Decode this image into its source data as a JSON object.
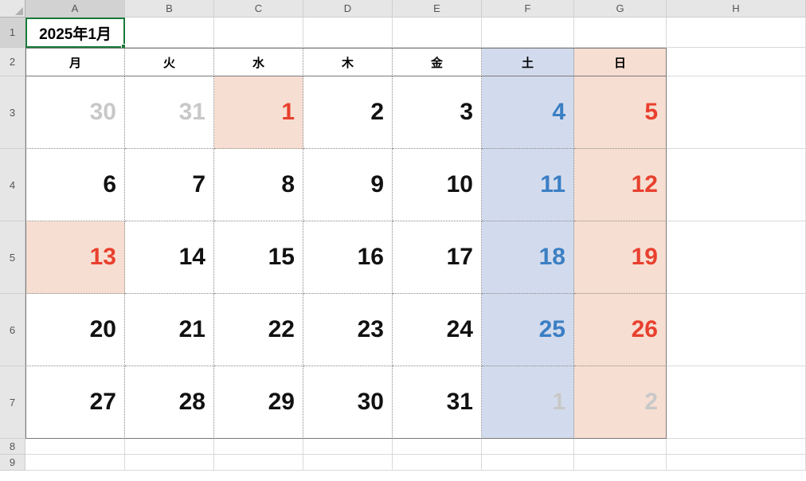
{
  "columns": [
    "A",
    "B",
    "C",
    "D",
    "E",
    "F",
    "G",
    "H"
  ],
  "rowNumbers": [
    "1",
    "2",
    "3",
    "4",
    "5",
    "6",
    "7",
    "8",
    "9"
  ],
  "title": "2025年1月",
  "dayHeaders": [
    {
      "label": "月",
      "cls": ""
    },
    {
      "label": "火",
      "cls": ""
    },
    {
      "label": "水",
      "cls": ""
    },
    {
      "label": "木",
      "cls": ""
    },
    {
      "label": "金",
      "cls": ""
    },
    {
      "label": "土",
      "cls": "bg-sat"
    },
    {
      "label": "日",
      "cls": "bg-sun"
    }
  ],
  "weeks": [
    [
      {
        "v": "30",
        "cls": "gray"
      },
      {
        "v": "31",
        "cls": "gray"
      },
      {
        "v": "1",
        "cls": "red",
        "bg": "bg-hol"
      },
      {
        "v": "2",
        "cls": "n"
      },
      {
        "v": "3",
        "cls": "n"
      },
      {
        "v": "4",
        "cls": "blue",
        "bg": "bg-sat"
      },
      {
        "v": "5",
        "cls": "red",
        "bg": "bg-sun"
      }
    ],
    [
      {
        "v": "6",
        "cls": "n"
      },
      {
        "v": "7",
        "cls": "n"
      },
      {
        "v": "8",
        "cls": "n"
      },
      {
        "v": "9",
        "cls": "n"
      },
      {
        "v": "10",
        "cls": "n"
      },
      {
        "v": "11",
        "cls": "blue",
        "bg": "bg-sat"
      },
      {
        "v": "12",
        "cls": "red",
        "bg": "bg-sun"
      }
    ],
    [
      {
        "v": "13",
        "cls": "red",
        "bg": "bg-hol"
      },
      {
        "v": "14",
        "cls": "n"
      },
      {
        "v": "15",
        "cls": "n"
      },
      {
        "v": "16",
        "cls": "n"
      },
      {
        "v": "17",
        "cls": "n"
      },
      {
        "v": "18",
        "cls": "blue",
        "bg": "bg-sat"
      },
      {
        "v": "19",
        "cls": "red",
        "bg": "bg-sun"
      }
    ],
    [
      {
        "v": "20",
        "cls": "n"
      },
      {
        "v": "21",
        "cls": "n"
      },
      {
        "v": "22",
        "cls": "n"
      },
      {
        "v": "23",
        "cls": "n"
      },
      {
        "v": "24",
        "cls": "n"
      },
      {
        "v": "25",
        "cls": "blue",
        "bg": "bg-sat"
      },
      {
        "v": "26",
        "cls": "red",
        "bg": "bg-sun"
      }
    ],
    [
      {
        "v": "27",
        "cls": "n"
      },
      {
        "v": "28",
        "cls": "n"
      },
      {
        "v": "29",
        "cls": "n"
      },
      {
        "v": "30",
        "cls": "n"
      },
      {
        "v": "31",
        "cls": "n"
      },
      {
        "v": "1",
        "cls": "gray",
        "bg": "bg-sat"
      },
      {
        "v": "2",
        "cls": "gray",
        "bg": "bg-sun"
      }
    ]
  ],
  "colors": {
    "sat_bg": "#d2dbed",
    "sun_bg": "#f7ded2",
    "sat_text": "#3b7fc4",
    "sun_text": "#e8402e"
  }
}
